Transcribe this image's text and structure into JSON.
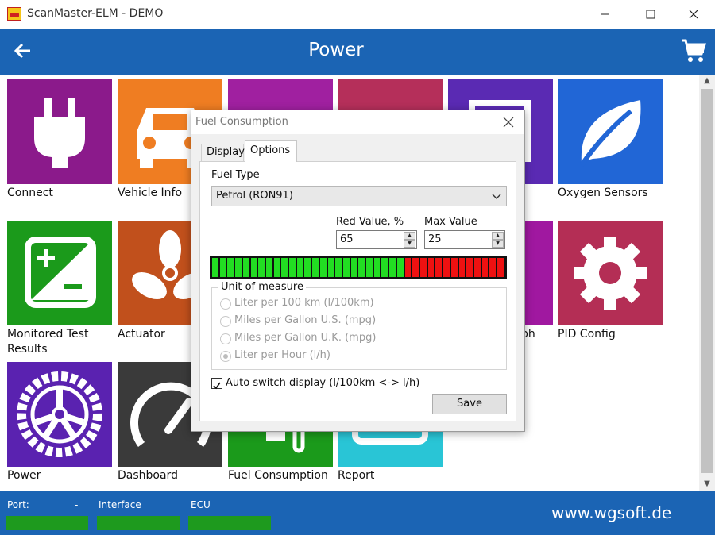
{
  "window": {
    "title": "ScanMaster-ELM - DEMO"
  },
  "header": {
    "title": "Power",
    "back_icon": "arrow-left-icon",
    "cart_icon": "shopping-cart-icon"
  },
  "tiles": [
    {
      "label": "Connect",
      "color": "#8b1a8b",
      "icon": "plug-icon"
    },
    {
      "label": "Vehicle Info",
      "color": "#ef7d22",
      "icon": "car-icon"
    },
    {
      "label": "",
      "color": "#a020a0",
      "icon": "tile-icon"
    },
    {
      "label": "",
      "color": "#b52f5a",
      "icon": "tile-icon"
    },
    {
      "label": "",
      "color": "#5a2ab3",
      "icon": "tile-icon"
    },
    {
      "label": "Oxygen Sensors",
      "color": "#2166d6",
      "icon": "leaf-icon"
    },
    {
      "label": "Monitored Test Results",
      "color": "#1b9a1b",
      "icon": "monitor-test-icon"
    },
    {
      "label": "Actuator",
      "color": "#c1501c",
      "icon": "fan-icon"
    },
    {
      "label": "",
      "color": "#a018a0",
      "icon": "tile-icon"
    },
    {
      "label": "PID Config",
      "color": "#b42e55",
      "icon": "gear-icon"
    },
    {
      "label": "Power",
      "color": "#5a22b0",
      "icon": "wheel-icon"
    },
    {
      "label": "Dashboard",
      "color": "#3a3a3a",
      "icon": "gauge-icon"
    },
    {
      "label": "Fuel Consumption",
      "color": "#1b9a1b",
      "icon": "fuel-icon"
    },
    {
      "label": "Report",
      "color": "#29c5d6",
      "icon": "report-icon"
    }
  ],
  "partial_labels": {
    "graph_suffix": "ph"
  },
  "status": {
    "port_label": "Port:",
    "port_value": "-",
    "interface_label": "Interface",
    "ecu_label": "ECU",
    "website": "www.wgsoft.de",
    "bar_color": "#1e9a1e"
  },
  "dialog": {
    "title": "Fuel Consumption",
    "tabs": [
      "Display",
      "Options"
    ],
    "active_tab": "Options",
    "fuel_type_label": "Fuel Type",
    "fuel_type_value": "Petrol (RON91)",
    "red_value_label": "Red Value, %",
    "red_value": "65",
    "max_value_label": "Max Value",
    "max_value": "25",
    "gauge": {
      "total_segments": 38,
      "red_from_segment": 25,
      "green": "#22dd22",
      "red": "#ee1111"
    },
    "unit_group_label": "Unit of measure",
    "units": [
      {
        "label": "Liter per 100 km (l/100km)",
        "checked": false
      },
      {
        "label": "Miles per Gallon U.S.  (mpg)",
        "checked": false
      },
      {
        "label": "Miles per Gallon U.K. (mpg)",
        "checked": false
      },
      {
        "label": "Liter per Hour (l/h)",
        "checked": true
      }
    ],
    "auto_switch_label": "Auto switch display (l/100km <-> l/h)",
    "auto_switch_checked": true,
    "save_label": "Save"
  }
}
